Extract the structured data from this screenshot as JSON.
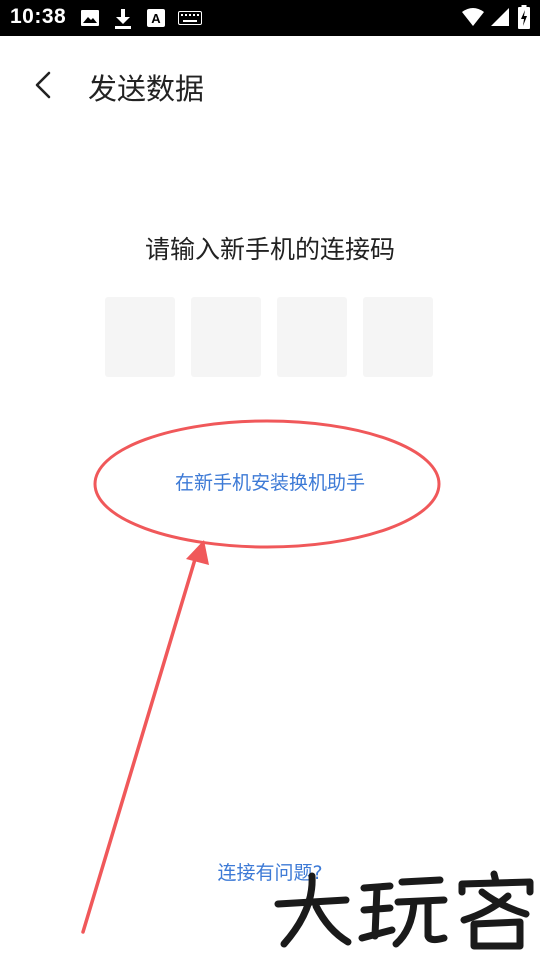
{
  "status_bar": {
    "time": "10:38",
    "left_icons": [
      "image-icon",
      "download-icon",
      "a-badge-icon",
      "keyboard-icon"
    ],
    "right_icons": [
      "wifi-icon",
      "cellular-signal-icon",
      "battery-charging-icon"
    ]
  },
  "app_bar": {
    "back_icon": "chevron-left-icon",
    "title": "发送数据"
  },
  "main": {
    "prompt": "请输入新手机的连接码",
    "code_inputs": [
      "",
      "",
      "",
      ""
    ],
    "install_helper_link": "在新手机安装换机助手",
    "connection_problem_link": "连接有问题?"
  },
  "annotation": {
    "color": "#f0585a"
  },
  "colors": {
    "link": "#3d7ad6",
    "code_box_bg": "#f5f5f5",
    "status_bar_bg": "#000000"
  }
}
